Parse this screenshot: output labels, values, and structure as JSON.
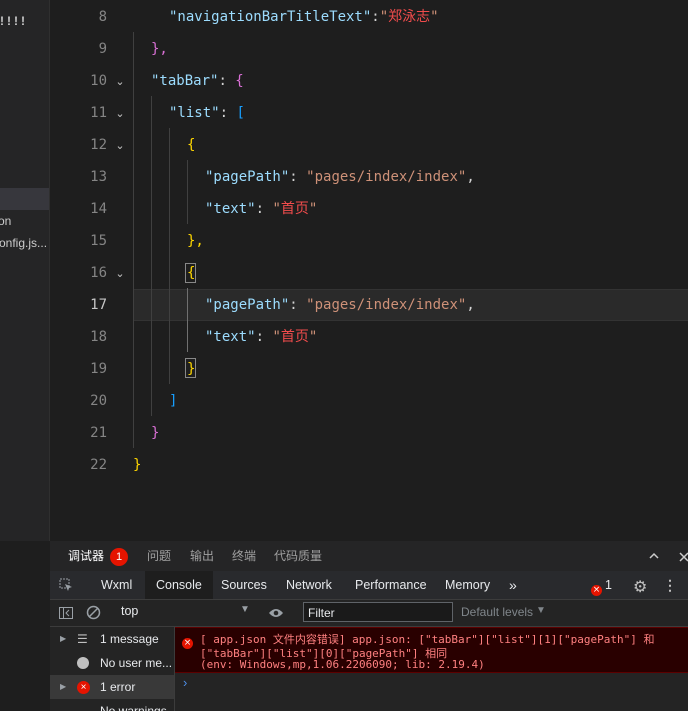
{
  "explorer": {
    "items": [
      "!!!!",
      "on",
      "onfig.js..."
    ]
  },
  "editor": {
    "lines": [
      {
        "n": "8"
      },
      {
        "n": "9"
      },
      {
        "n": "10"
      },
      {
        "n": "11"
      },
      {
        "n": "12"
      },
      {
        "n": "13"
      },
      {
        "n": "14"
      },
      {
        "n": "15"
      },
      {
        "n": "16"
      },
      {
        "n": "17"
      },
      {
        "n": "18"
      },
      {
        "n": "19"
      },
      {
        "n": "20"
      },
      {
        "n": "21"
      },
      {
        "n": "22"
      }
    ],
    "tokens": {
      "l8_key": "\"navigationBarTitleText\"",
      "l8_colon": ":",
      "l8_val": "\"郑泳志\"",
      "l9": "},",
      "l10_key": "\"tabBar\"",
      "l10_colon": ": ",
      "l10_brace": "{",
      "l11_key": "\"list\"",
      "l11_colon": ": ",
      "l11_bracket": "[",
      "l12": "{",
      "l13_key": "\"pagePath\"",
      "l13_colon": ": ",
      "l13_val": "\"pages/index/index\"",
      "l13_comma": ",",
      "l14_key": "\"text\"",
      "l14_colon": ": ",
      "l14_val": "\"首页\"",
      "l15": "},",
      "l16": "{",
      "l17_key": "\"pagePath\"",
      "l17_colon": ": ",
      "l17_val": "\"pages/index/index\"",
      "l17_comma": ",",
      "l18_key": "\"text\"",
      "l18_colon": ": ",
      "l18_val": "\"首页\"",
      "l19": "}",
      "l20": "]",
      "l21": "}",
      "l22": "}"
    }
  },
  "panel": {
    "tabs": [
      "调试器",
      "问题",
      "输出",
      "终端",
      "代码质量"
    ],
    "debugger_badge": "1",
    "devtools_tabs": [
      "Wxml",
      "Console",
      "Sources",
      "Network",
      "Performance",
      "Memory"
    ],
    "error_count": "1",
    "context": "top",
    "filter_placeholder": "Filter",
    "levels": "Default levels",
    "sidebar": [
      "1 message",
      "No user me...",
      "1 error",
      "No warnings"
    ],
    "error_lines": [
      "[ app.json 文件内容错误] app.json: [\"tabBar\"][\"list\"][1][\"pagePath\"] 和",
      "[\"tabBar\"][\"list\"][0][\"pagePath\"] 相同",
      "(env: Windows,mp,1.06.2206090; lib: 2.19.4)"
    ]
  },
  "colors": {
    "accent_error": "#e51400",
    "bg_editor": "#1e1e1e",
    "string": "#ce9178",
    "key": "#9cdcfe"
  }
}
